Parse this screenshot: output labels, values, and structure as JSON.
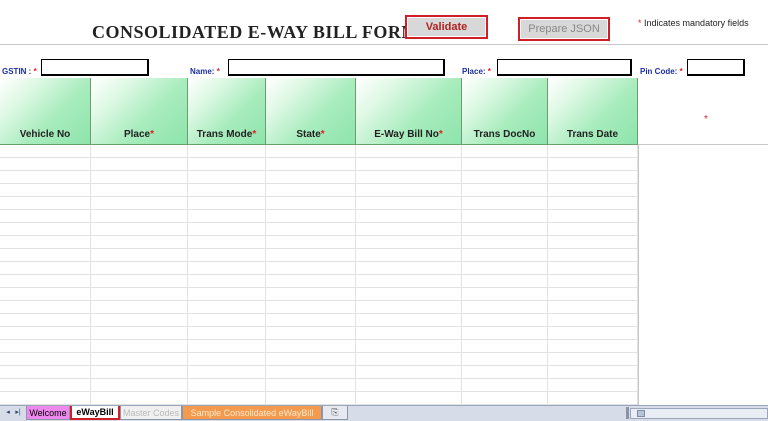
{
  "form": {
    "title": "CONSOLIDATED  E-WAY BILL FORM",
    "validate_label": "Validate",
    "prepare_json_label": "Prepare JSON",
    "mandatory_star": "*",
    "mandatory_note": "Indicates mandatory fields"
  },
  "fields": {
    "gstin_label": "GSTIN : ",
    "name_label": "Name: ",
    "place_label": "Place: ",
    "pincode_label": "Pin Code: ",
    "star": "*",
    "gstin_value": "",
    "name_value": "",
    "place_value": "",
    "pincode_value": ""
  },
  "table": {
    "columns": [
      {
        "label": "Vehicle No",
        "required": false
      },
      {
        "label": "Place",
        "required": true
      },
      {
        "label": "Trans Mode",
        "required": true
      },
      {
        "label": "State",
        "required": true
      },
      {
        "label": "E-Way Bill No",
        "required": true
      },
      {
        "label": "Trans DocNo",
        "required": false
      },
      {
        "label": "Trans Date",
        "required": false
      }
    ],
    "required_marker": "*",
    "side_marker": "*",
    "rows": 20
  },
  "sheet_tabs": {
    "nav_first": "◂",
    "nav_last": "▸|",
    "welcome": "Welcome",
    "eway": "eWayBill",
    "master": "Master Codes",
    "sample": "Sample Consolidated eWayBill",
    "new_sheet": "⎘"
  },
  "colors": {
    "accent_red": "#d01f26",
    "header_green": "#8ee4ac",
    "label_blue": "#1a2fa0"
  }
}
